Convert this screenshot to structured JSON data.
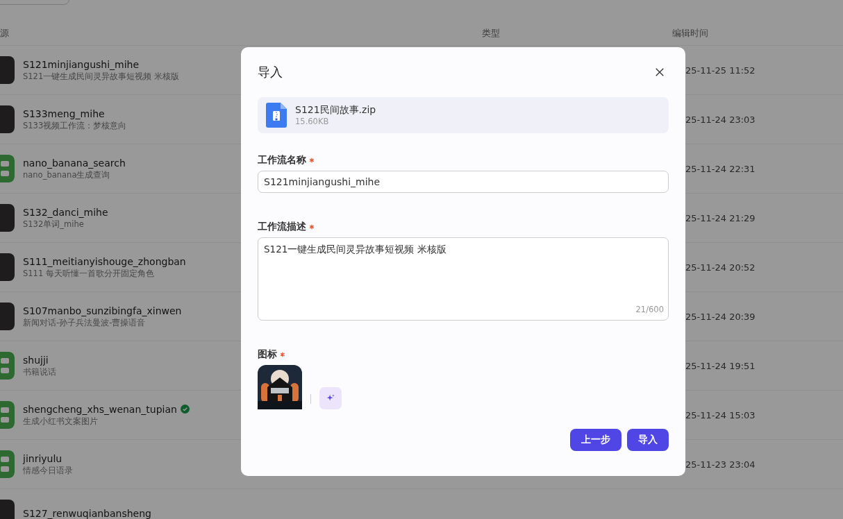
{
  "table": {
    "columns": [
      {
        "label": "源"
      },
      {
        "label": "类型"
      },
      {
        "label": "编辑时间"
      }
    ],
    "rows": [
      {
        "name": "S121minjiangushi_mihe",
        "description": "S121一键生成民间灵异故事短视频 米核版",
        "kind": "image",
        "verified": false,
        "time": "25-11-25 11:52"
      },
      {
        "name": "S133meng_mihe",
        "description": "S133视频工作流：梦核意向",
        "kind": "image",
        "verified": false,
        "time": "25-11-24 23:03"
      },
      {
        "name": "nano_banana_search",
        "description": "nano_banana生成查询",
        "kind": "workflow",
        "verified": false,
        "time": "25-11-24 22:31"
      },
      {
        "name": "S132_danci_mihe",
        "description": "S132单词_mihe",
        "kind": "image",
        "verified": false,
        "time": "25-11-24 21:29"
      },
      {
        "name": "S111_meitianyishouge_zhongban",
        "description": "S111 每天听懂一首歌分开固定角色",
        "kind": "image",
        "verified": false,
        "time": "25-11-24 20:52"
      },
      {
        "name": "S107manbo_sunzibingfa_xinwen",
        "description": "新闻对话-孙子兵法曼波-曹操语音",
        "kind": "image",
        "verified": false,
        "time": "25-11-24 20:39"
      },
      {
        "name": "shujji",
        "description": "书籍说话",
        "kind": "workflow",
        "verified": false,
        "time": "25-11-24 19:51"
      },
      {
        "name": "shengcheng_xhs_wenan_tupian",
        "description": "生成小红书文案图片",
        "kind": "workflow",
        "verified": true,
        "time": "25-11-24 15:03"
      },
      {
        "name": "jinriyulu",
        "description": "情感今日语录",
        "kind": "workflow",
        "verified": false,
        "time": "25-11-23 23:04"
      },
      {
        "name": "S127_renwuqianbansheng",
        "kind": "image",
        "verified": false
      }
    ]
  },
  "dialog": {
    "title": "导入",
    "file": {
      "name": "S121民间故事.zip",
      "size": "15.60KB"
    },
    "fields": [
      {
        "kind": "input",
        "label": "工作流名称",
        "required": true,
        "value": "S121minjiangushi_mihe"
      },
      {
        "kind": "textarea",
        "label": "工作流描述",
        "required": true,
        "value": "S121一键生成民间灵异故事短视频 米核版",
        "counter": "21/600"
      },
      {
        "kind": "icon",
        "label": "图标",
        "required": true
      }
    ],
    "buttons": [
      {
        "label": "上一步"
      },
      {
        "label": "导入"
      }
    ]
  }
}
